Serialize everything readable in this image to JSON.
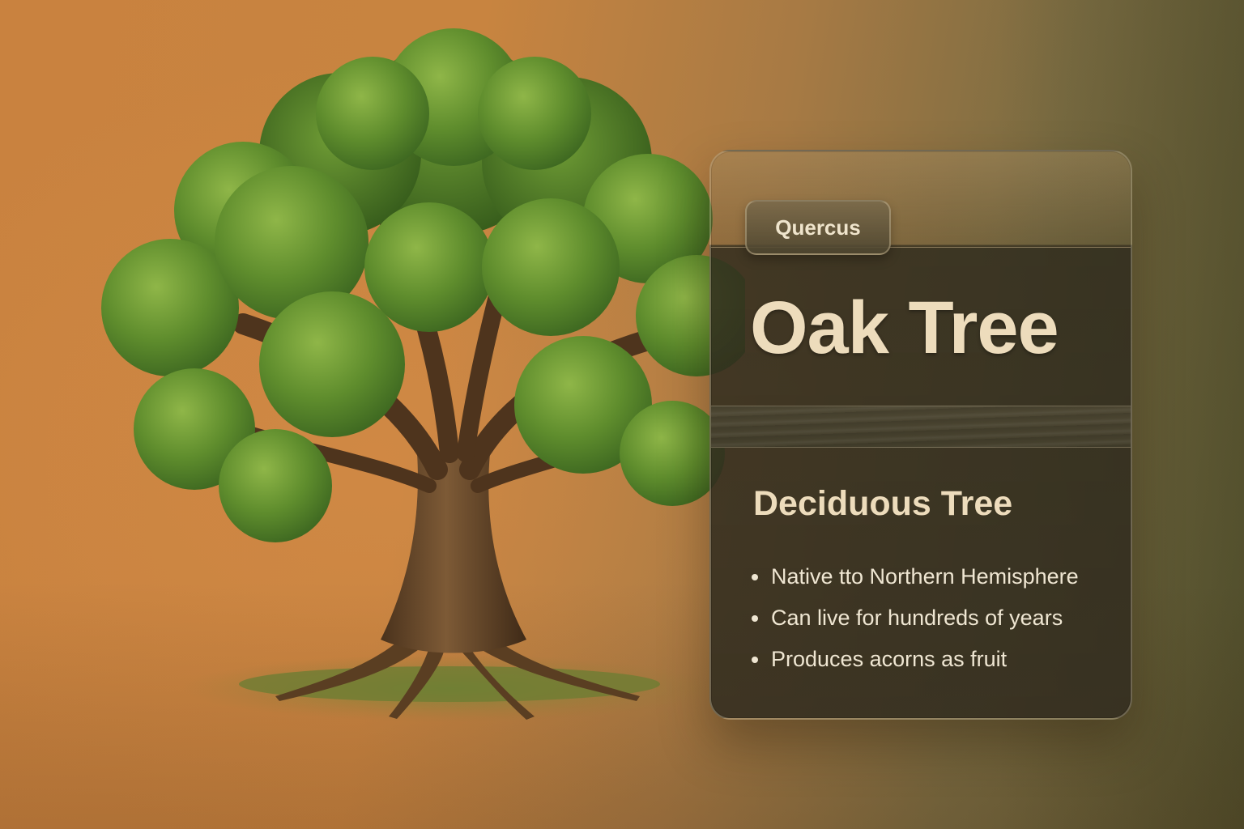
{
  "card": {
    "genus": "Quercus",
    "title": "Oak Tree",
    "subtitle": "Deciduous Tree",
    "facts": [
      "Native tto Northern Hemisphere",
      "Can live for hundreds of years",
      "Produces acorns as fruit"
    ]
  },
  "colors": {
    "background_warm": "#c9823f",
    "background_olive": "#5c5a34",
    "card_dark": "#302c1e",
    "text_cream": "#eddcbc",
    "foliage": "#5e8a2c",
    "trunk": "#6a4a2c"
  },
  "icons": [
    "oak-tree-illustration"
  ]
}
